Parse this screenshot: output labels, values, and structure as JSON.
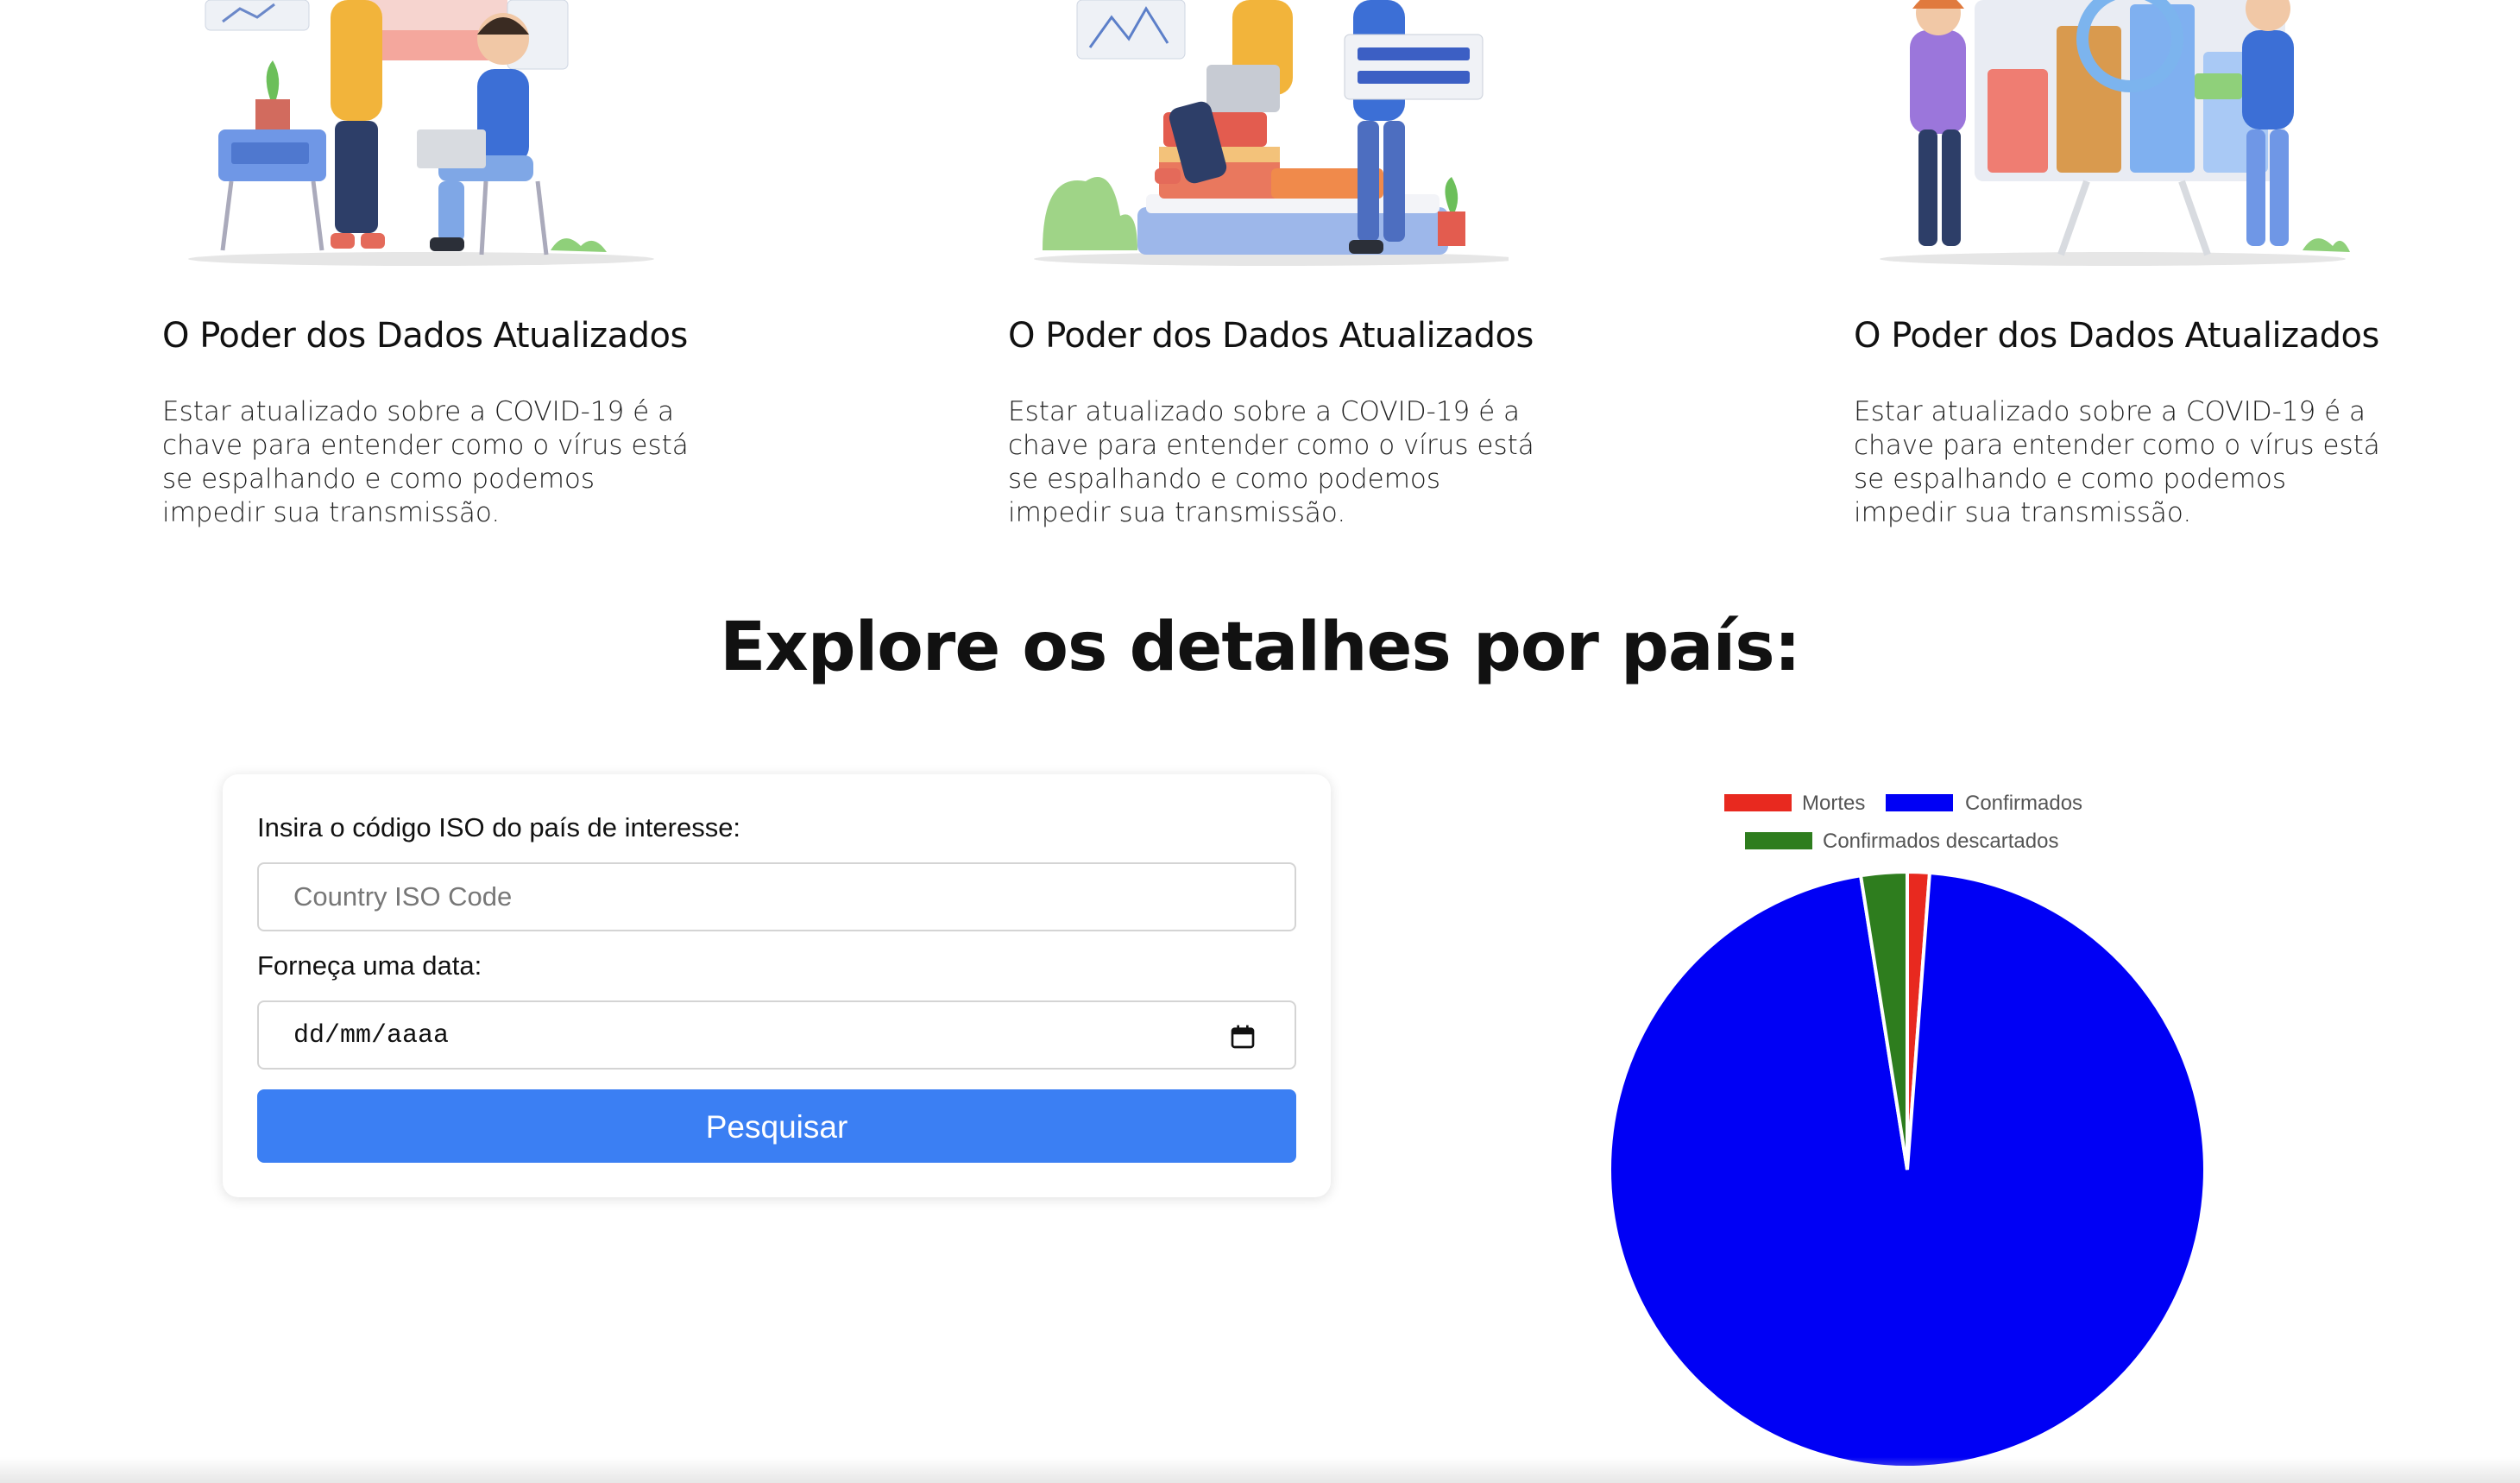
{
  "features": [
    {
      "title": "O Poder dos Dados Atualizados",
      "text": "Estar atualizado sobre a COVID-19 é a chave para entender como o vírus está se espalhando e como podemos impedir sua transmissão."
    },
    {
      "title": "O Poder dos Dados Atualizados",
      "text": "Estar atualizado sobre a COVID-19 é a chave para entender como o vírus está se espalhando e como podemos impedir sua transmissão."
    },
    {
      "title": "O Poder dos Dados Atualizados",
      "text": "Estar atualizado sobre a COVID-19 é a chave para entender como o vírus está se espalhando e como podemos impedir sua transmissão."
    }
  ],
  "section": {
    "title": "Explore os detalhes por país:"
  },
  "form": {
    "iso_label": "Insira o código ISO do país de interesse:",
    "iso_placeholder": "Country ISO Code",
    "date_label": "Forneça uma data:",
    "date_placeholder": "dd/mm/aaaa",
    "submit_label": "Pesquisar"
  },
  "colors": {
    "accent": "#3b7ff3",
    "deaths": "#e8291f",
    "confirmed": "#0000f5",
    "discarded": "#2e7d1e"
  },
  "chart_data": {
    "type": "pie",
    "title": "",
    "legend_position": "top",
    "series": [
      {
        "name": "Mortes",
        "value": 1.2,
        "color": "#e8291f"
      },
      {
        "name": "Confirmados",
        "value": 96.3,
        "color": "#0000f5"
      },
      {
        "name": "Confirmados descartados",
        "value": 2.5,
        "color": "#2e7d1e"
      }
    ]
  }
}
